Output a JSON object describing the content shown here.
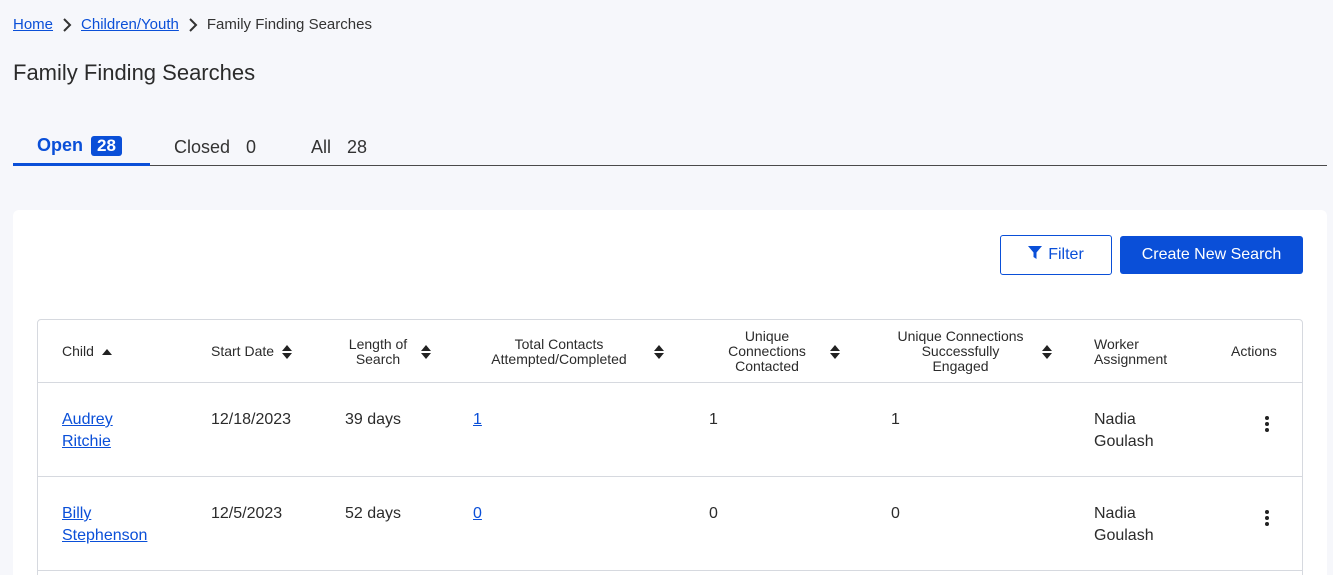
{
  "breadcrumb": {
    "home": "Home",
    "section": "Children/Youth",
    "current": "Family Finding Searches"
  },
  "page_title": "Family Finding Searches",
  "tabs": [
    {
      "label": "Open",
      "count": "28"
    },
    {
      "label": "Closed",
      "count": "0"
    },
    {
      "label": "All",
      "count": "28"
    }
  ],
  "toolbar": {
    "filter_label": "Filter",
    "create_label": "Create New Search"
  },
  "table": {
    "columns": [
      "Child",
      "Start Date",
      "Length of Search",
      "Total Contacts Attempted/Completed",
      "Unique Connections Contacted",
      "Unique Connections Successfully Engaged",
      "Worker Assignment",
      "Actions"
    ],
    "rows": [
      {
        "child_first": "Audrey",
        "child_last": "Ritchie",
        "start_date": "12/18/2023",
        "length": "39 days",
        "total_contacts": "1",
        "unique_contacted": "1",
        "unique_engaged": "1",
        "worker_first": "Nadia",
        "worker_last": "Goulash"
      },
      {
        "child_first": "Billy",
        "child_last": "Stephenson",
        "start_date": "12/5/2023",
        "length": "52 days",
        "total_contacts": "0",
        "unique_contacted": "0",
        "unique_engaged": "0",
        "worker_first": "Nadia",
        "worker_last": "Goulash"
      }
    ]
  },
  "colors": {
    "accent": "#0a4fd8",
    "background": "#f6f7fb",
    "panel": "#ffffff"
  }
}
